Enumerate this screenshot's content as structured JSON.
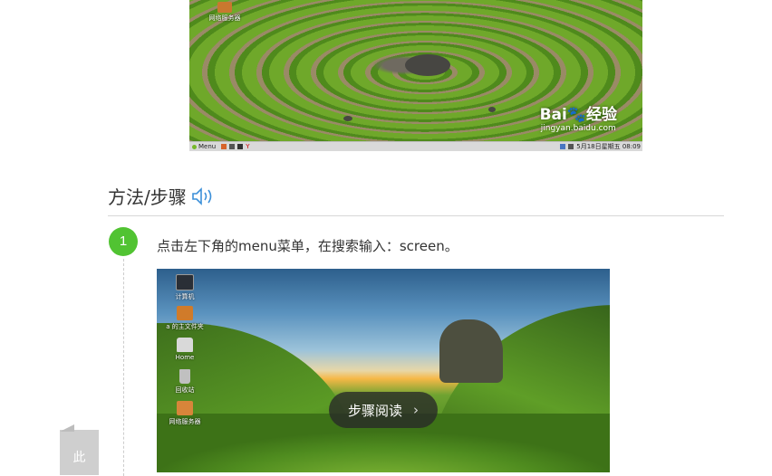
{
  "top_screenshot": {
    "desktop_icon_label": "网络服务器",
    "watermark": {
      "logo": "Bai🐾经验",
      "url": "jingyan.baidu.com"
    },
    "taskbar": {
      "menu_label": "Menu",
      "tray_text": "5月18日星期五 08:09",
      "app_letter": "Y"
    }
  },
  "section": {
    "title": "方法/步骤"
  },
  "step": {
    "number": "1",
    "text": "点击左下角的menu菜单，在搜索输入：screen。",
    "screenshot": {
      "desktop_icons": [
        {
          "label": "计算机",
          "icon": "computer-icon"
        },
        {
          "label": "a 的主文件夹",
          "icon": "folder-icon"
        },
        {
          "label": "Home",
          "icon": "home-icon"
        },
        {
          "label": "回收站",
          "icon": "trash-icon"
        },
        {
          "label": "网络服务器",
          "icon": "network-server-icon"
        }
      ],
      "read_steps_button": "步骤阅读"
    }
  },
  "side_tab": {
    "label": "此"
  },
  "colors": {
    "step_badge": "#51c332",
    "divider": "#d8d8d8",
    "speaker": "#3b8fd9"
  }
}
